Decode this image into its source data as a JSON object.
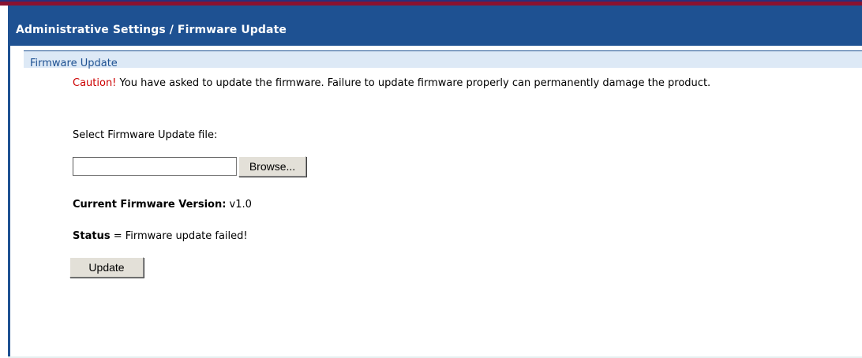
{
  "header": {
    "title": "Administrative Settings / Firmware Update"
  },
  "section": {
    "title": "Firmware Update"
  },
  "caution": {
    "label": "Caution!",
    "message": " You have asked to update the firmware. Failure to update firmware properly can permanently damage the product."
  },
  "file_select": {
    "label": "Select Firmware Update file:",
    "value": "",
    "browse_label": "Browse..."
  },
  "firmware": {
    "version_label": "Current Firmware Version:",
    "version_value": " v1.0"
  },
  "status": {
    "label": "Status",
    "separator": " = ",
    "value": "Firmware update failed!"
  },
  "actions": {
    "update_label": "Update"
  },
  "colors": {
    "title_bar": "#1e5192",
    "caution": "#cc0000",
    "section_header_bg": "#dde9f6",
    "top_stripe": "#8a1230"
  }
}
